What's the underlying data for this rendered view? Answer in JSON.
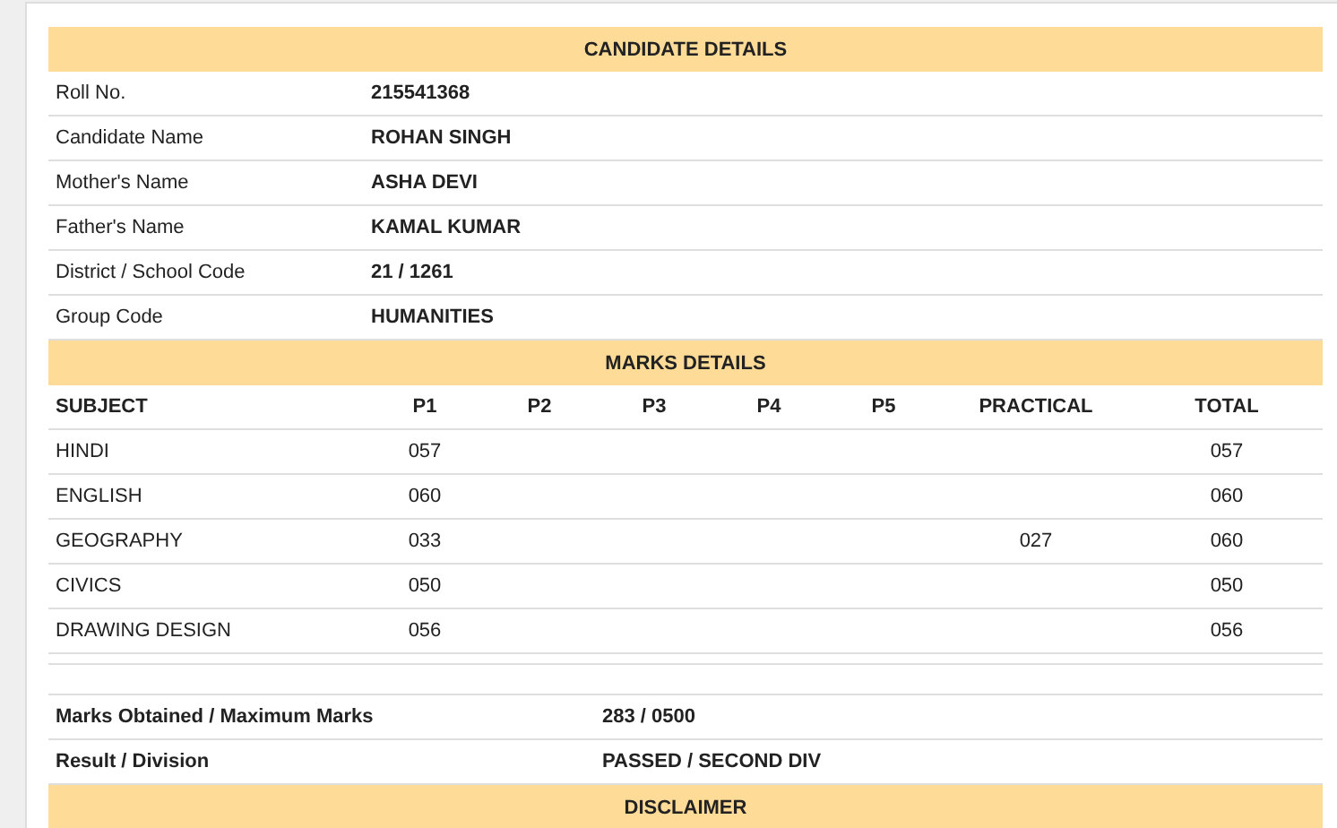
{
  "candidate_details": {
    "title": "CANDIDATE DETAILS",
    "rows": [
      {
        "label": "Roll No.",
        "value": "215541368"
      },
      {
        "label": "Candidate Name",
        "value": "ROHAN SINGH"
      },
      {
        "label": "Mother's Name",
        "value": "ASHA DEVI"
      },
      {
        "label": "Father's Name",
        "value": "KAMAL KUMAR"
      },
      {
        "label": "District / School Code",
        "value": "21 / 1261"
      },
      {
        "label": "Group Code",
        "value": "HUMANITIES"
      }
    ]
  },
  "marks_details": {
    "title": "MARKS DETAILS",
    "columns": [
      "SUBJECT",
      "P1",
      "P2",
      "P3",
      "P4",
      "P5",
      "PRACTICAL",
      "TOTAL"
    ],
    "rows": [
      {
        "cells": [
          "HINDI",
          "057",
          "",
          "",
          "",
          "",
          "",
          "057"
        ]
      },
      {
        "cells": [
          "ENGLISH",
          "060",
          "",
          "",
          "",
          "",
          "",
          "060"
        ]
      },
      {
        "cells": [
          "GEOGRAPHY",
          "033",
          "",
          "",
          "",
          "",
          "027",
          "060"
        ]
      },
      {
        "cells": [
          "CIVICS",
          "050",
          "",
          "",
          "",
          "",
          "",
          "050"
        ]
      },
      {
        "cells": [
          "DRAWING DESIGN",
          "056",
          "",
          "",
          "",
          "",
          "",
          "056"
        ]
      }
    ]
  },
  "summary": [
    {
      "label": "Marks Obtained / Maximum Marks",
      "value": "283 / 0500"
    },
    {
      "label": "Result / Division",
      "value": "PASSED / SECOND DIV"
    }
  ],
  "disclaimer": {
    "title": "DISCLAIMER"
  }
}
